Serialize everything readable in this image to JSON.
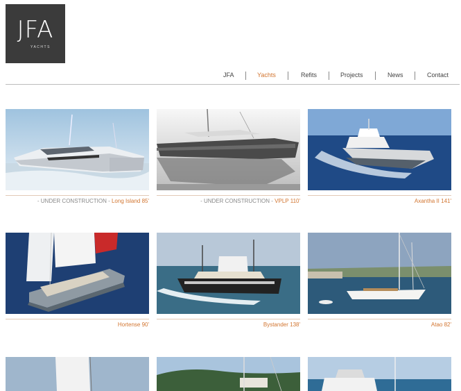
{
  "logo": {
    "mark": "JFA",
    "sub": "YACHTS"
  },
  "nav": [
    {
      "label": "JFA",
      "active": false
    },
    {
      "label": "Yachts",
      "active": true
    },
    {
      "label": "Refits",
      "active": false
    },
    {
      "label": "Projects",
      "active": false
    },
    {
      "label": "News",
      "active": false
    },
    {
      "label": "Contact",
      "active": false
    }
  ],
  "yachts": [
    {
      "note": "- UNDER CONSTRUCTION - ",
      "name": "Long Island 85'"
    },
    {
      "note": "- UNDER CONSTRUCTION - ",
      "name": "VPLP 110'"
    },
    {
      "note": "",
      "name": "Axantha II 141'"
    },
    {
      "note": "",
      "name": "Hortense 90'"
    },
    {
      "note": "",
      "name": "Bystander 138'"
    },
    {
      "note": "",
      "name": "Atao 82'"
    }
  ]
}
